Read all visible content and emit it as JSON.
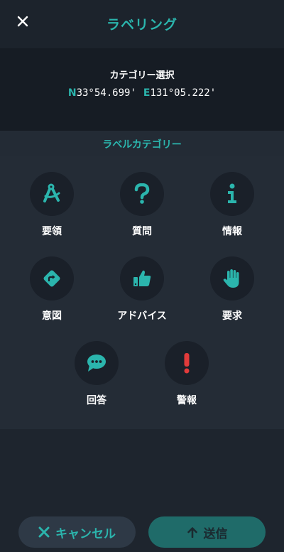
{
  "header": {
    "title": "ラベリング"
  },
  "selection": {
    "title": "カテゴリー選択",
    "lat_dir": "N",
    "lat_value": "33°54.699'",
    "lon_dir": "E",
    "lon_value": "131°05.222'"
  },
  "label_category": {
    "title": "ラベルカテゴリー",
    "items": [
      {
        "label": "要領",
        "icon": "drafting-compass-icon"
      },
      {
        "label": "質問",
        "icon": "question-icon"
      },
      {
        "label": "情報",
        "icon": "info-icon"
      },
      {
        "label": "意図",
        "icon": "route-arrow-icon"
      },
      {
        "label": "アドバイス",
        "icon": "thumbs-up-icon"
      },
      {
        "label": "要求",
        "icon": "raised-hand-icon"
      },
      {
        "label": "回答",
        "icon": "chat-bubble-icon"
      },
      {
        "label": "警報",
        "icon": "exclamation-icon"
      }
    ]
  },
  "actions": {
    "cancel_label": "キャンセル",
    "send_label": "送信"
  },
  "colors": {
    "accent": "#2bb5ad",
    "alert": "#e23b3b",
    "background": "#1e252e"
  }
}
